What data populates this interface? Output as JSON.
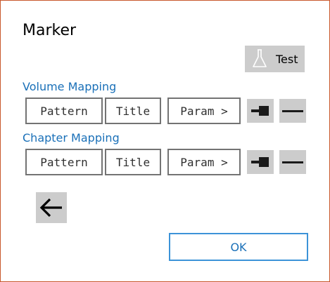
{
  "dialog": {
    "title": "Marker",
    "test_label": "Test",
    "ok_label": "OK"
  },
  "volume_mapping": {
    "label": "Volume Mapping",
    "pattern_label": "Pattern",
    "title_label": "Title",
    "param_label": "Param >"
  },
  "chapter_mapping": {
    "label": "Chapter Mapping",
    "pattern_label": "Pattern",
    "title_label": "Title",
    "param_label": "Param >"
  },
  "icons": {
    "test": "flask-icon",
    "connect": "connector-icon",
    "remove": "minus-icon",
    "back": "back-arrow-icon"
  },
  "colors": {
    "accent": "#1a70b8",
    "button_gray": "#cccccc",
    "field_border": "#737373",
    "window_border": "#c8582c",
    "ok_border": "#3c93d8"
  }
}
